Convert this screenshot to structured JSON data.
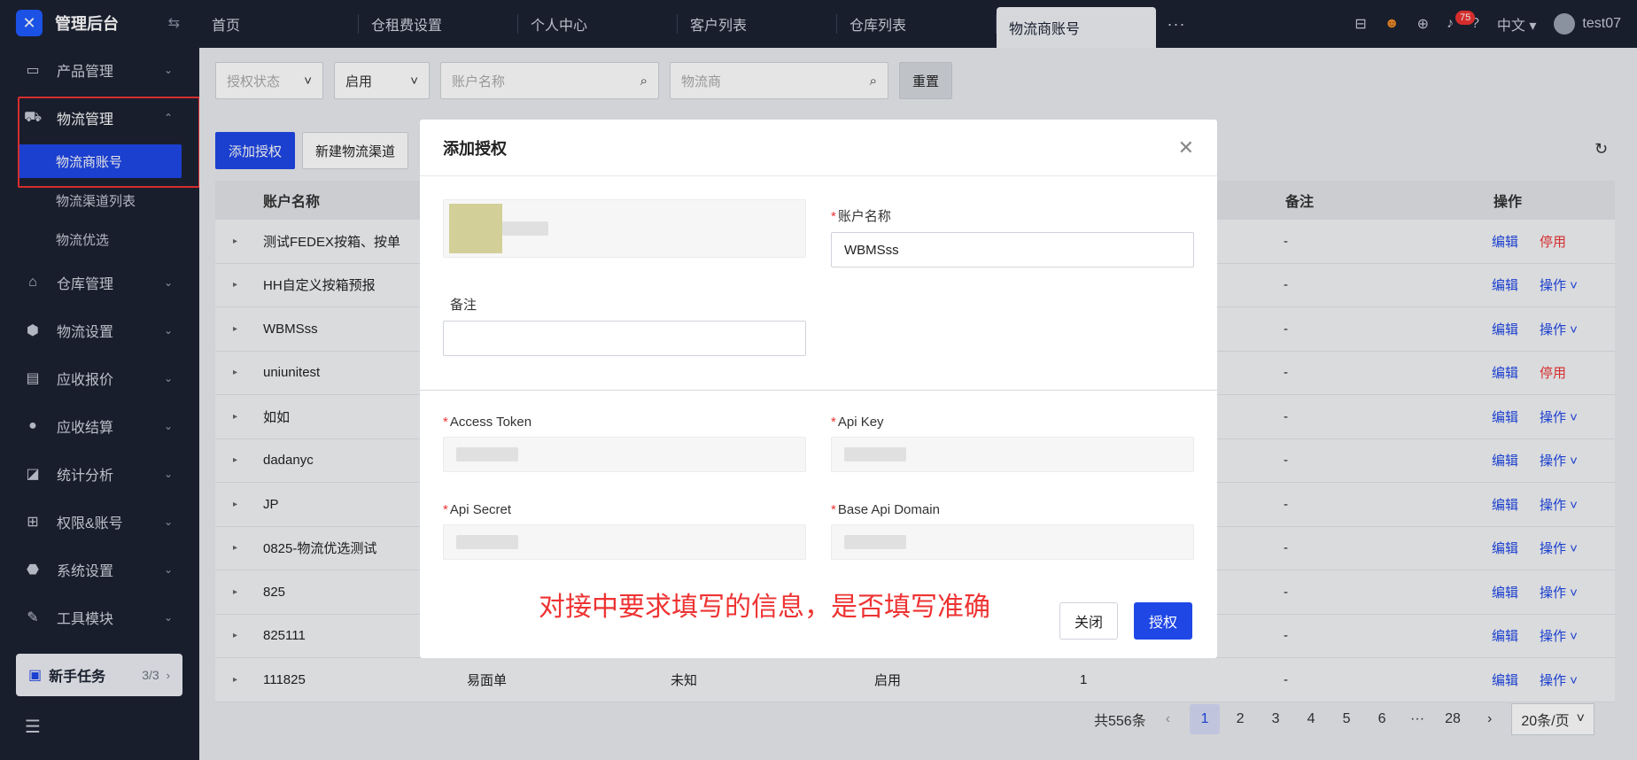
{
  "app": {
    "title": "管理后台"
  },
  "sidebar": {
    "items": [
      {
        "label": "产品管理",
        "icon": "box-icon"
      },
      {
        "label": "物流管理",
        "icon": "truck-icon",
        "open": true,
        "children": [
          {
            "label": "物流商账号",
            "active": true
          },
          {
            "label": "物流渠道列表"
          },
          {
            "label": "物流优选"
          }
        ]
      },
      {
        "label": "仓库管理",
        "icon": "warehouse-icon"
      },
      {
        "label": "物流设置",
        "icon": "package-icon"
      },
      {
        "label": "应收报价",
        "icon": "document-icon"
      },
      {
        "label": "应收结算",
        "icon": "coin-icon"
      },
      {
        "label": "统计分析",
        "icon": "chart-icon"
      },
      {
        "label": "权限&账号",
        "icon": "org-icon"
      },
      {
        "label": "系统设置",
        "icon": "settings-icon"
      },
      {
        "label": "工具模块",
        "icon": "wrench-icon"
      }
    ],
    "task": {
      "label": "新手任务",
      "count": "3/3"
    }
  },
  "tabs": [
    "首页",
    "仓租费设置",
    "个人中心",
    "客户列表",
    "仓库列表",
    "物流商账号"
  ],
  "topbar": {
    "notif_count": "75",
    "language": "中文",
    "user": "test07"
  },
  "filters": {
    "auth_status_placeholder": "授权状态",
    "enable_value": "启用",
    "account_placeholder": "账户名称",
    "provider_placeholder": "物流商",
    "reset": "重置"
  },
  "actions": {
    "add_auth": "添加授权",
    "new_channel": "新建物流渠道"
  },
  "table": {
    "headers": {
      "name": "账户名称",
      "note": "备注",
      "op": "操作"
    },
    "rows": [
      {
        "name": "测试FEDEX按箱、按单",
        "note": "-",
        "op1": "编辑",
        "op2": "停用",
        "op2_red": true
      },
      {
        "name": "HH自定义按箱预报",
        "note": "-",
        "op1": "编辑",
        "op2": "操作 ˅"
      },
      {
        "name": "WBMSss",
        "note": "-",
        "op1": "编辑",
        "op2": "操作 ˅"
      },
      {
        "name": "uniunitest",
        "note": "-",
        "op1": "编辑",
        "op2": "停用",
        "op2_red": true
      },
      {
        "name": "如如",
        "note": "-",
        "op1": "编辑",
        "op2": "操作 ˅"
      },
      {
        "name": "dadanyc",
        "note": "-",
        "op1": "编辑",
        "op2": "操作 ˅"
      },
      {
        "name": "JP",
        "note": "-",
        "op1": "编辑",
        "op2": "操作 ˅"
      },
      {
        "name": "0825-物流优选测试",
        "note": "-",
        "op1": "编辑",
        "op2": "操作 ˅"
      },
      {
        "name": "825",
        "note": "-",
        "op1": "编辑",
        "op2": "操作 ˅"
      },
      {
        "name": "825111",
        "note": "-",
        "op1": "编辑",
        "op2": "操作 ˅"
      },
      {
        "name": "111825",
        "b": "易面单",
        "c": "未知",
        "d": "启用",
        "e": "1",
        "note": "-",
        "op1": "编辑",
        "op2": "操作 ˅"
      }
    ]
  },
  "pagination": {
    "total": "共556条",
    "pages": [
      "1",
      "2",
      "3",
      "4",
      "5",
      "6",
      "···",
      "28"
    ],
    "page_size": "20条/页"
  },
  "modal": {
    "title": "添加授权",
    "account_label": "账户名称",
    "account_value": "WBMSss",
    "note_label": "备注",
    "access_token_label": "Access Token",
    "api_key_label": "Api Key",
    "api_secret_label": "Api Secret",
    "base_api_domain_label": "Base Api Domain",
    "annotation": "对接中要求填写的信息，是否填写准确",
    "close": "关闭",
    "authorize": "授权"
  }
}
